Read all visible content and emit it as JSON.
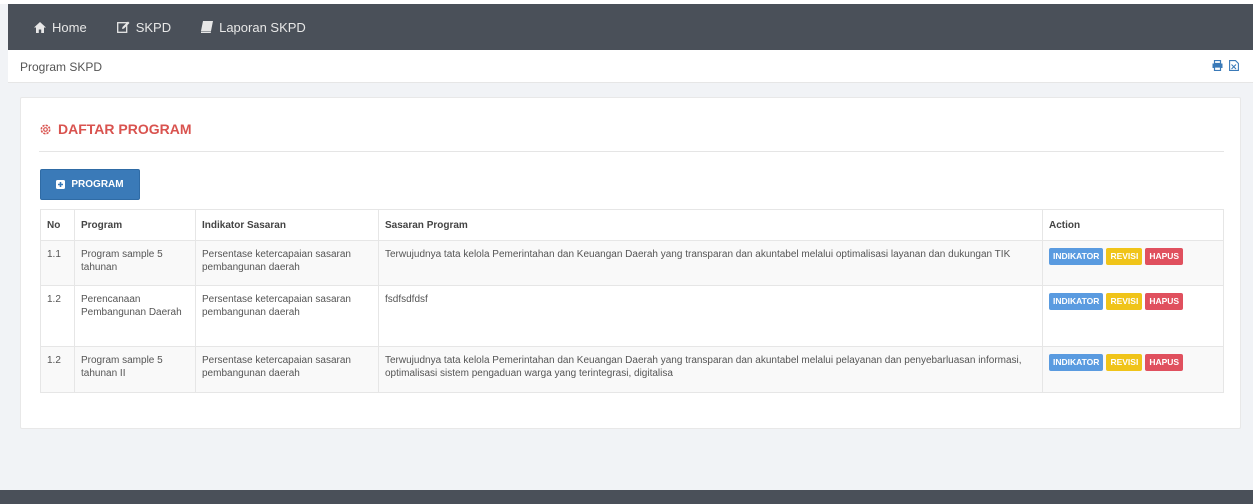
{
  "nav": {
    "items": [
      {
        "label": "Home",
        "icon": "home-icon"
      },
      {
        "label": "SKPD",
        "icon": "edit-icon"
      },
      {
        "label": "Laporan SKPD",
        "icon": "book-icon"
      }
    ]
  },
  "breadcrumb": "Program SKPD",
  "panel": {
    "title": "DAFTAR PROGRAM",
    "add_button": "PROGRAM"
  },
  "table": {
    "headers": {
      "no": "No",
      "program": "Program",
      "indikator": "Indikator Sasaran",
      "sasaran": "Sasaran Program",
      "action": "Action"
    },
    "rows": [
      {
        "no": "1.1",
        "program": "Program sample 5 tahunan",
        "indikator": "Persentase ketercapaian sasaran pembangunan daerah",
        "sasaran": "Terwujudnya tata kelola Pemerintahan dan Keuangan Daerah yang transparan dan akuntabel melalui optimalisasi layanan dan dukungan TIK"
      },
      {
        "no": "1.2",
        "program": "Perencanaan Pembangunan Daerah",
        "indikator": "Persentase ketercapaian sasaran pembangunan daerah",
        "sasaran": "fsdfsdfdsf"
      },
      {
        "no": "1.2",
        "program": "Program sample 5 tahunan II",
        "indikator": "Persentase ketercapaian sasaran pembangunan daerah",
        "sasaran": "Terwujudnya tata kelola Pemerintahan dan Keuangan Daerah yang transparan dan akuntabel melalui pelayanan dan penyebarluasan informasi, optimalisasi sistem pengaduan warga yang terintegrasi, digitalisa"
      }
    ],
    "actions": {
      "indikator": "INDIKATOR",
      "revisi": "REVISI",
      "hapus": "HAPUS"
    }
  },
  "colors": {
    "nav": "#4a5059",
    "title": "#d9534f",
    "primary": "#3a7ab8",
    "indikator": "#5a9be0",
    "revisi": "#f0c419",
    "hapus": "#e0505e"
  }
}
